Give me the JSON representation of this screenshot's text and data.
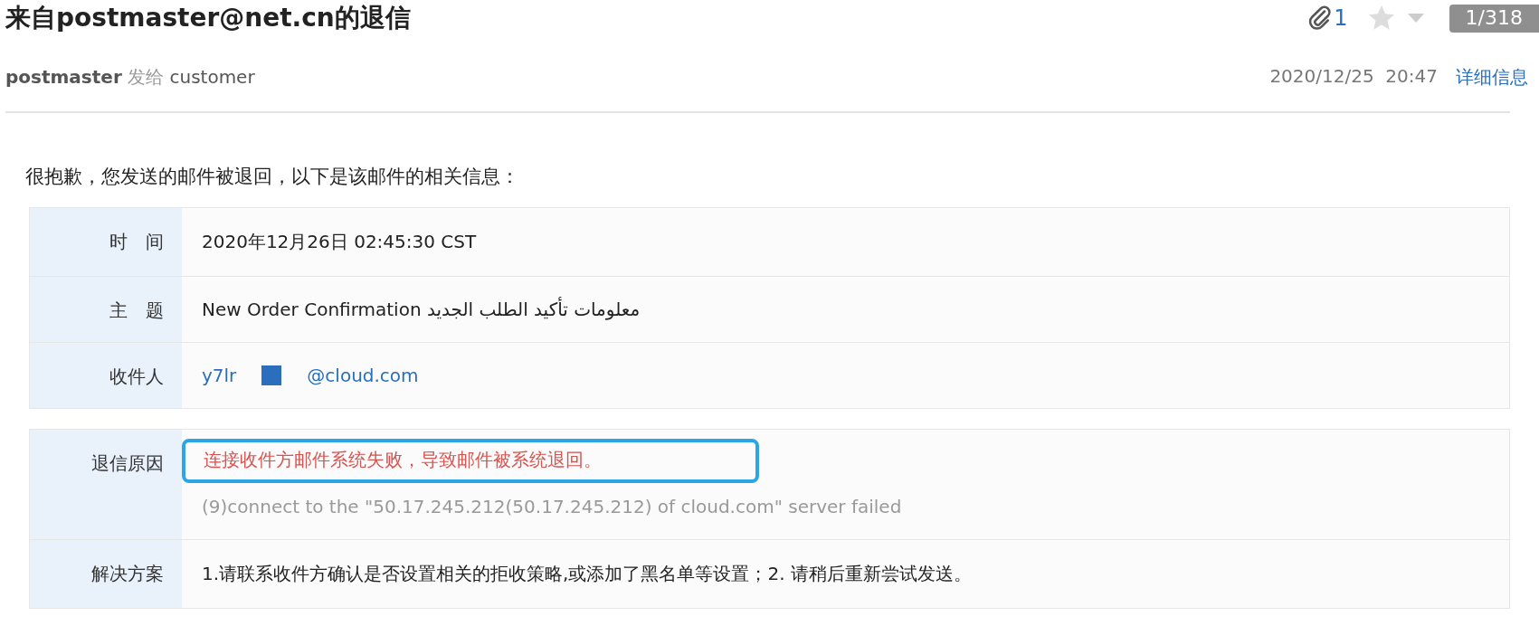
{
  "header": {
    "title": "来自postmaster@net.cn的退信",
    "attachment_count": "1",
    "starred": false,
    "pager": "1/318",
    "sender": "postmaster",
    "sent_to_label": "发给",
    "recipient": "customer",
    "date": "2020/12/25",
    "time": "20:47",
    "details_link": "详细信息"
  },
  "intro": "很抱歉，您发送的邮件被退回，以下是该邮件的相关信息：",
  "info_table": [
    {
      "label": "时　间",
      "kind": "text",
      "value": "2020年12月26日 02:45:30 CST"
    },
    {
      "label": "主　题",
      "kind": "text",
      "value": "New Order Confirmation معلومات تأكيد الطلب الجديد"
    },
    {
      "label": "收件人",
      "kind": "address",
      "value": "y7lr",
      "value_end": "@cloud.com"
    }
  ],
  "bounce_table": [
    {
      "label": "退信原因",
      "kind": "reason",
      "value": "连接收件方邮件系统失败，导致邮件被系统退回。",
      "detail": "(9)connect to the \"50.17.245.212(50.17.245.212) of cloud.com\" server failed",
      "highlighted": true
    },
    {
      "label": "解决方案",
      "kind": "text",
      "value": "1.请联系收件方确认是否设置相关的拒收策略,或添加了黑名单等设置；2. 请稍后重新尝试发送。"
    }
  ]
}
